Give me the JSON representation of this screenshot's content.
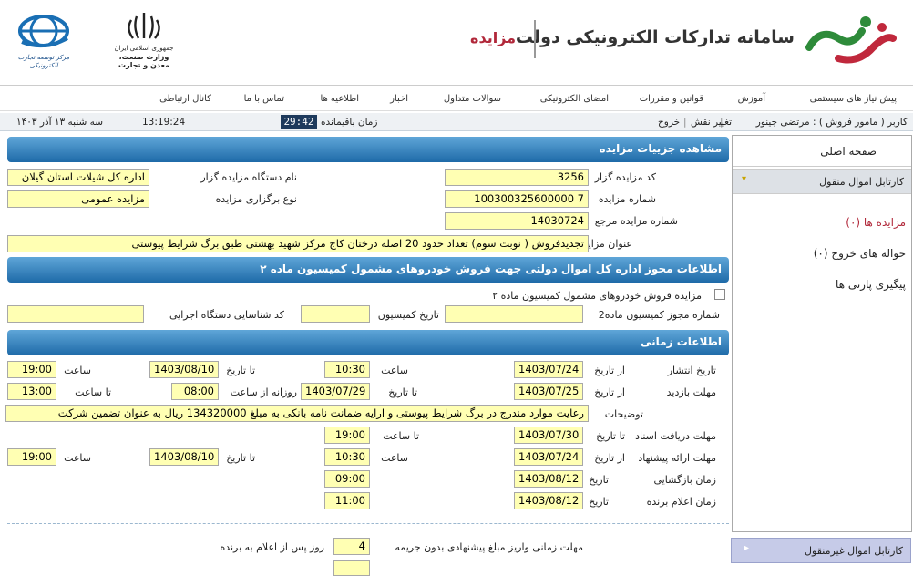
{
  "header": {
    "site_title": "سامانه تدارکات الکترونیکی دولت",
    "section_title": "مزایده",
    "emblem_text": "جمهوری اسلامی ایران",
    "ministry_text": "وزارت صنعت، معدن و تجارت",
    "trade_org_text": "مرکز توسعه تجارت الکترونیکی"
  },
  "nav": {
    "items": [
      "پیش نیاز های سیستمی",
      "آموزش",
      "قوانین و مقررات",
      "امضای الکترونیکی",
      "سوالات متداول",
      "اخبار",
      "اطلاعیه ها",
      "تماس با ما",
      "کانال ارتباطی"
    ]
  },
  "userbar": {
    "user": "کاربر ( مامور فروش ) : مرتضی جینور",
    "change_role": "تغییر نقش",
    "logout": "خروج",
    "remaining_label": "زمان باقیمانده",
    "timer": "29:42",
    "clock": "13:19:24",
    "date": "سه شنبه ۱۳ آذر ۱۴۰۳"
  },
  "sections": {
    "details": "مشاهده جزییات مزایده",
    "license": "اطلاعات مجوز اداره کل اموال دولتی جهت فروش خودروهای مشمول کمیسیون ماده ۲",
    "timing": "اطلاعات زمانی"
  },
  "details": {
    "auctioneer_code_label": "کد مزایده گزار",
    "auctioneer_code": "3256",
    "auctioneer_name_label": "نام دستگاه مزایده گزار",
    "auctioneer_name": "اداره کل شیلات استان گیلان",
    "auction_number_label": "شماره مزایده",
    "auction_number": "100300325600000 7",
    "auction_type_label": "نوع برگزاری مزایده",
    "auction_type": "مزایده عمومی",
    "ref_number_label": "شماره مزایده مرجع",
    "ref_number": "14030724",
    "title_label": "عنوان مزایده",
    "title": "تجدیدفروش ( نوبت سوم) تعداد حدود 20 اصله درختان کاج مرکز شهید بهشتی طبق برگ شرایط پیوستی"
  },
  "license": {
    "checkbox_label": "مزایده فروش خودروهای مشمول کمیسیون ماده ۲",
    "commission_number_label": "شماره مجوز کمیسیون ماده2",
    "commission_number": "",
    "commission_date_label": "تاریخ کمیسیون",
    "commission_date": "",
    "exec_code_label": "کد شناسایی دستگاه اجرایی",
    "exec_code": ""
  },
  "timing": {
    "publish_label": "تاریخ انتشار",
    "from_date_label": "از تاریخ",
    "publish_from": "1403/07/24",
    "time_label": "ساعت",
    "publish_time_from": "10:30",
    "to_date_label": "تا تاریخ",
    "publish_to": "1403/08/10",
    "publish_time_to": "19:00",
    "visit_label": "مهلت بازدید",
    "visit_from": "1403/07/25",
    "visit_to": "1403/07/29",
    "daily_from_label": "روزانه از ساعت",
    "visit_time_from": "08:00",
    "to_time_label": "تا ساعت",
    "visit_time_to": "13:00",
    "notes_label": "توضیحات",
    "notes": "رعایت موارد مندرج در برگ شرایط پیوستی و ارایه ضمانت نامه بانکی به مبلغ 134320000 ریال به عنوان تضمین شرکت",
    "receive_docs_label": "مهلت دریافت اسناد",
    "receive_docs_to": "1403/07/30",
    "to_time_label2": "تا ساعت",
    "receive_docs_time": "19:00",
    "offer_label": "مهلت ارائه پیشنهاد",
    "offer_from": "1403/07/24",
    "offer_time_from": "10:30",
    "offer_to": "1403/08/10",
    "offer_time_to": "19:00",
    "opening_label": "زمان بازگشایی",
    "date_label": "تاریخ",
    "opening_date": "1403/08/12",
    "opening_time": "09:00",
    "winner_label": "زمان اعلام برنده",
    "winner_date": "1403/08/12",
    "winner_time": "11:00",
    "payment_label": "مهلت زمانی واریز مبلغ پیشنهادی بدون جریمه",
    "payment_days": "4",
    "payment_suffix": "روز پس از اعلام به برنده"
  },
  "sidebar": {
    "home": "صفحه اصلی",
    "movable_cartable": "کارتابل اموال منقول",
    "auctions": "مزایده ها (۰)",
    "exit_orders": "حواله های خروج (۰)",
    "party_tracking": "پیگیری پارتی ها",
    "immovable_cartable": "کارتابل اموال غیرمنقول"
  },
  "colors": {
    "accent": "#b1283a",
    "section_bar": "#2f7fbf",
    "field_bg": "#ffffb3",
    "timer_bg": "#1e3a5c"
  }
}
